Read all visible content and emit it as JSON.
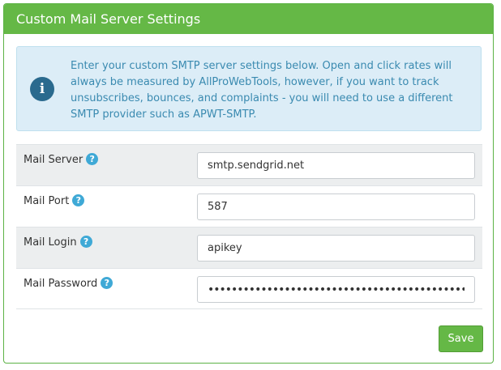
{
  "panel": {
    "title": "Custom Mail Server Settings"
  },
  "info": {
    "icon": "info-icon",
    "text": "Enter your custom SMTP server settings below. Open and click rates will always be measured by AllProWebTools, however, if you want to track unsubscribes, bounces, and complaints - you will need to use a different SMTP provider such as APWT-SMTP."
  },
  "fields": [
    {
      "label": "Mail Server",
      "value": "smtp.sendgrid.net",
      "help_icon": "help-icon"
    },
    {
      "label": "Mail Port",
      "value": "587",
      "help_icon": "help-icon"
    },
    {
      "label": "Mail Login",
      "value": "apikey",
      "help_icon": "help-icon"
    },
    {
      "label": "Mail Password",
      "value": "••••••••••••••••••••••••••••••••••••••••••••••••••••••••••••",
      "help_icon": "help-icon"
    }
  ],
  "help_glyph": "?",
  "info_glyph": "i",
  "save_label": "Save",
  "colors": {
    "header_green": "#65b846",
    "info_bg": "#dcedf7",
    "info_text": "#3a8ab0",
    "help_blue": "#3fa9d6"
  }
}
